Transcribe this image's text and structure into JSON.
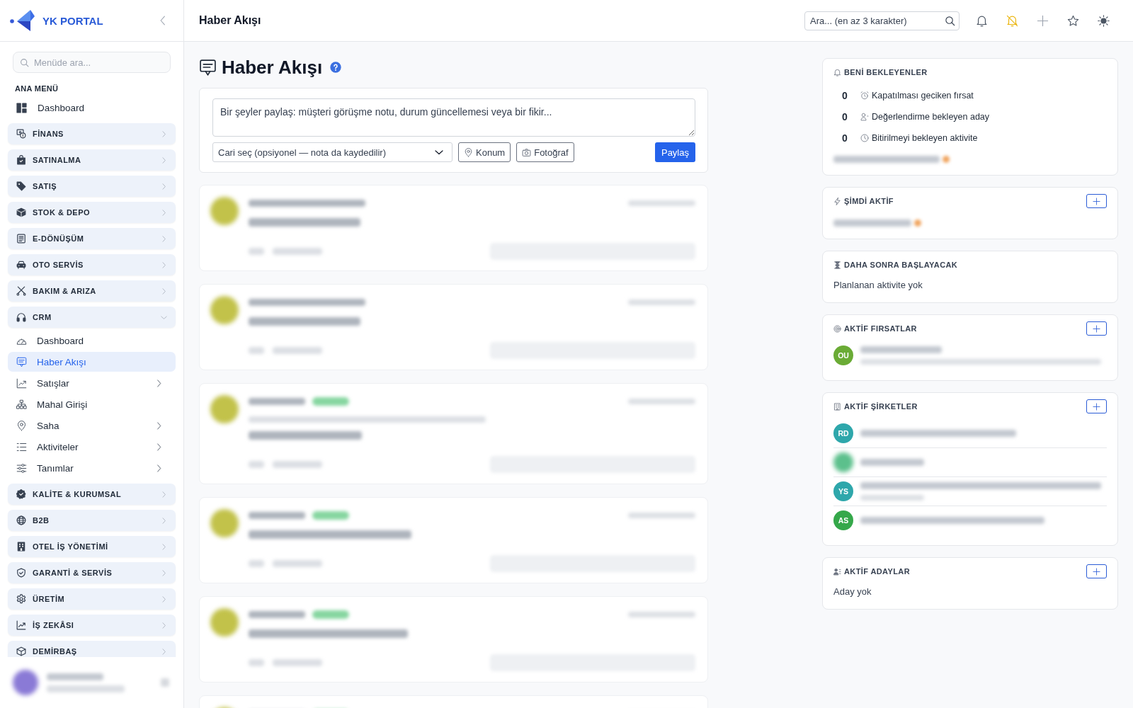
{
  "sidebar": {
    "brand": "YK PORTAL",
    "search": {
      "placeholder": "Menüde ara..."
    },
    "section_title": "ANA MENÜ",
    "items": [
      {
        "kind": "link",
        "label": "Dashboard",
        "selected": false
      },
      {
        "kind": "group",
        "label": "FİNANS",
        "expanded": false
      },
      {
        "kind": "group",
        "label": "SATINALMA",
        "expanded": false
      },
      {
        "kind": "group",
        "label": "SATIŞ",
        "expanded": false
      },
      {
        "kind": "group",
        "label": "STOK & DEPO",
        "expanded": false
      },
      {
        "kind": "group",
        "label": "E-DÖNÜŞÜM",
        "expanded": false
      },
      {
        "kind": "group",
        "label": "OTO SERVİS",
        "expanded": false
      },
      {
        "kind": "group",
        "label": "BAKIM & ARIZA",
        "expanded": false
      },
      {
        "kind": "group",
        "label": "CRM",
        "expanded": true,
        "children": [
          {
            "label": "Dashboard",
            "selected": false,
            "submenu": false
          },
          {
            "label": "Haber Akışı",
            "selected": true,
            "submenu": false
          },
          {
            "label": "Satışlar",
            "selected": false,
            "submenu": true
          },
          {
            "label": "Mahal Girişi",
            "selected": false,
            "submenu": false
          },
          {
            "label": "Saha",
            "selected": false,
            "submenu": true
          },
          {
            "label": "Aktiviteler",
            "selected": false,
            "submenu": true
          },
          {
            "label": "Tanımlar",
            "selected": false,
            "submenu": true
          }
        ]
      },
      {
        "kind": "group",
        "label": "KALİTE & KURUMSAL",
        "expanded": false
      },
      {
        "kind": "group",
        "label": "B2B",
        "expanded": false
      },
      {
        "kind": "group",
        "label": "OTEL İŞ YÖNETİMİ",
        "expanded": false
      },
      {
        "kind": "group",
        "label": "GARANTİ & SERVİS",
        "expanded": false
      },
      {
        "kind": "group",
        "label": "ÜRETİM",
        "expanded": false
      },
      {
        "kind": "group",
        "label": "İŞ ZEKÂSI",
        "expanded": false
      },
      {
        "kind": "group",
        "label": "DEMİRBAŞ",
        "expanded": false
      }
    ]
  },
  "topbar": {
    "title": "Haber Akışı",
    "search": {
      "placeholder": "Ara... (en az 3 karakter)"
    }
  },
  "page": {
    "title": "Haber Akışı",
    "composer": {
      "placeholder": "Bir şeyler paylaş: müşteri görüşme notu, durum güncellemesi veya bir fikir...",
      "customer_select": {
        "placeholder": "Cari seç (opsiyonel — nota da kaydedilir)"
      },
      "buttons": [
        {
          "kind": "outline",
          "label": "Konum"
        },
        {
          "kind": "outline",
          "label": "Fotoğraf"
        },
        {
          "kind": "primary",
          "label": "Paylaş"
        }
      ]
    },
    "widgets": [
      {
        "kind": "counts",
        "title": "BENİ BEKLEYENLER",
        "add_button": false,
        "rows": [
          {
            "count": "0",
            "label": "Kapatılması geciken fırsat"
          },
          {
            "count": "0",
            "label": "Değerlendirme bekleyen aday"
          },
          {
            "count": "0",
            "label": "Bitirilmeyi bekleyen aktivite"
          }
        ]
      },
      {
        "kind": "blurred",
        "title": "ŞİMDİ AKTİF",
        "add_button": true
      },
      {
        "kind": "empty",
        "title": "DAHA SONRA BAŞLAYACAK",
        "add_button": false,
        "empty_text": "Planlanan aktivite yok"
      },
      {
        "kind": "entities",
        "title": "AKTİF FIRSATLAR",
        "add_button": true,
        "items": [
          {
            "initials": "OU",
            "color": "#6aab35"
          }
        ]
      },
      {
        "kind": "entities",
        "title": "AKTİF ŞİRKETLER",
        "add_button": true,
        "items": [
          {
            "initials": "RD",
            "color": "#2ea7ab"
          },
          {
            "color": "#5cc08c"
          },
          {
            "initials": "YS",
            "color": "#2ea7ab"
          },
          {
            "initials": "AS",
            "color": "#35a84a"
          }
        ]
      },
      {
        "kind": "empty",
        "title": "AKTİF ADAYLAR",
        "add_button": true,
        "empty_text": "Aday yok"
      }
    ]
  }
}
